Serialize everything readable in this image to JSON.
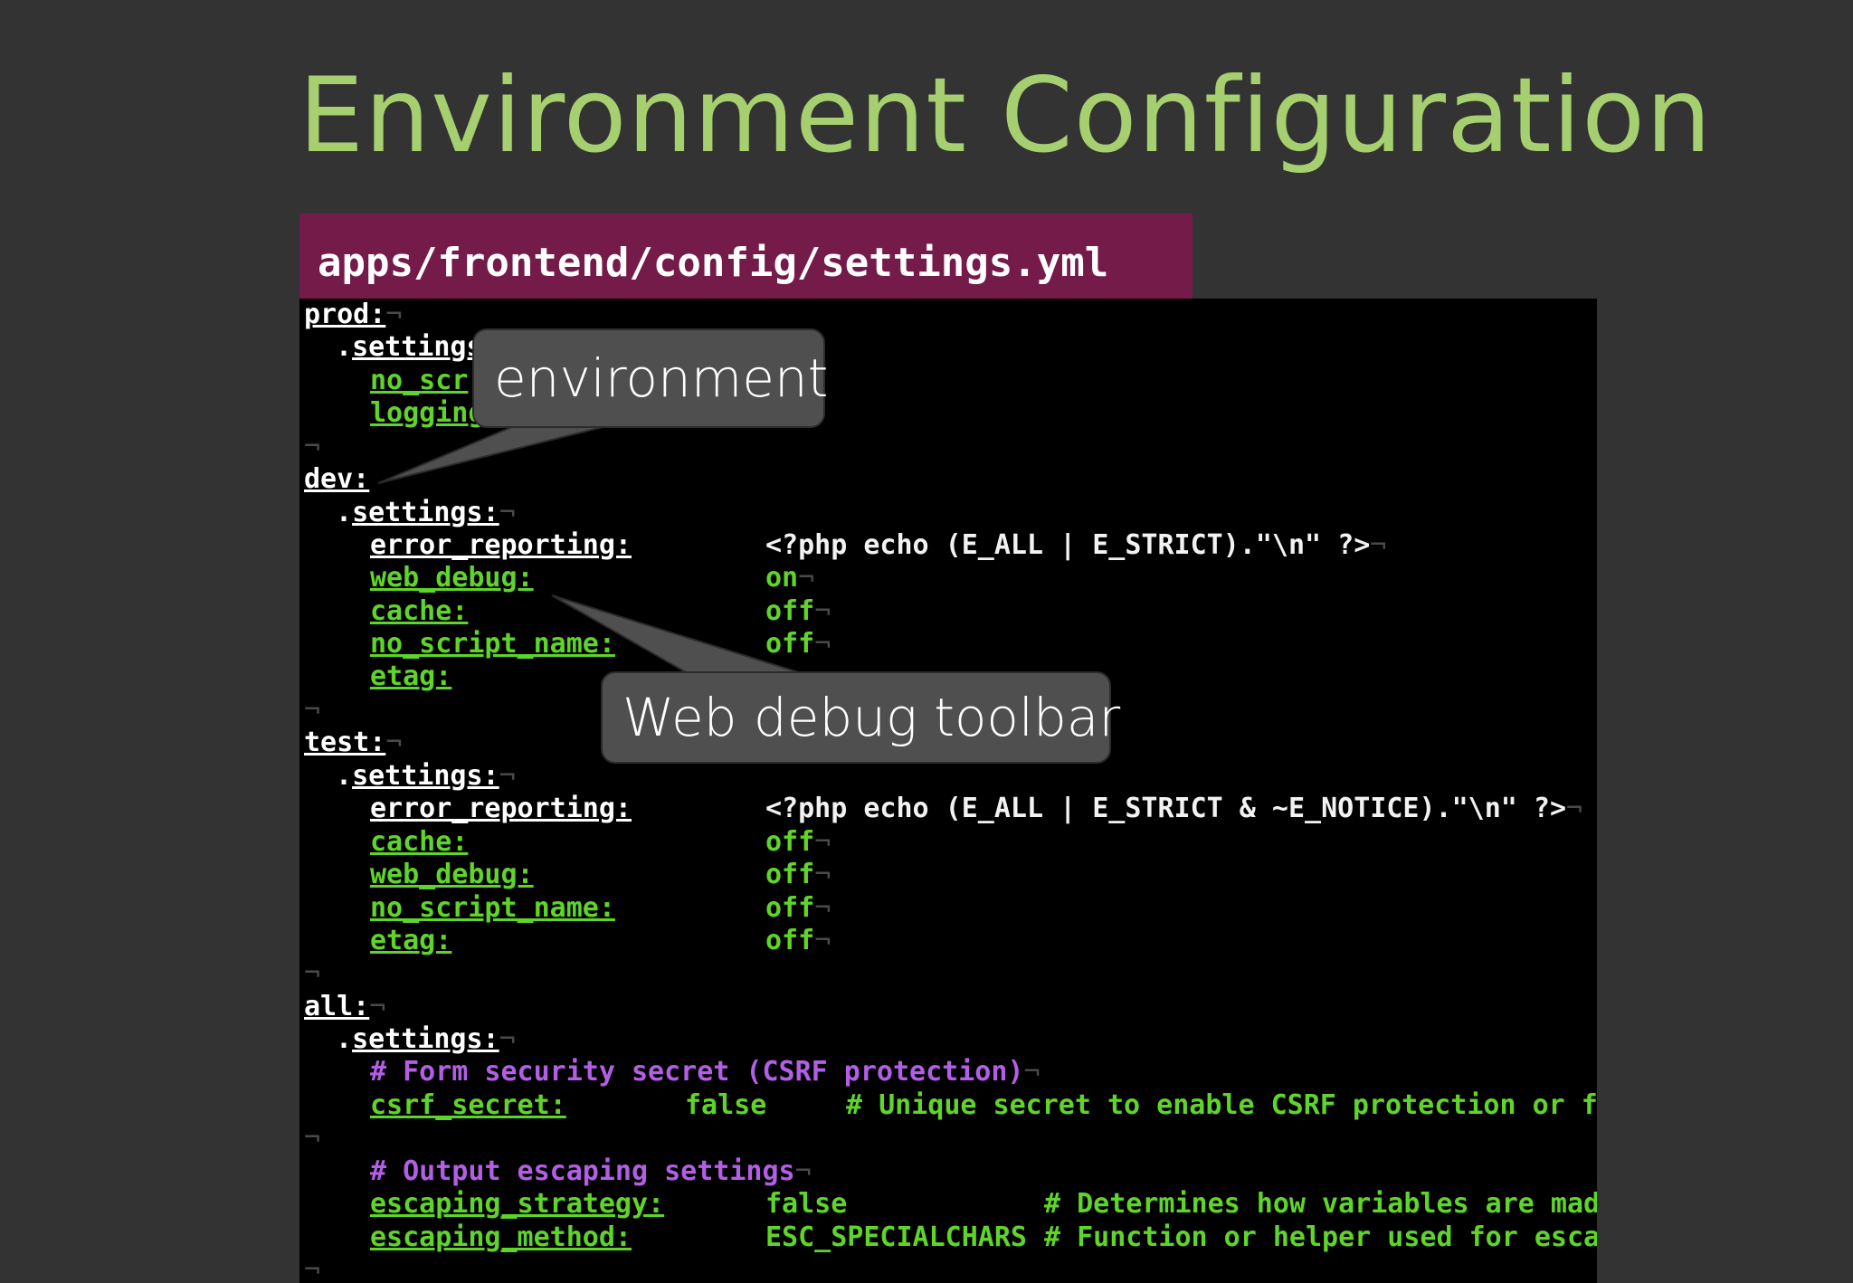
{
  "slide": {
    "title": "Environment Configuration",
    "file_path": "apps/frontend/config/settings.yml"
  },
  "code": {
    "prod_env": "prod:",
    "prod_settings": "settings",
    "prod_row1_key": "no_scr",
    "prod_row2_key": "logging",
    "dev_env": "dev:",
    "dev_settings": "settings:",
    "dev_rows": [
      {
        "key": "error_reporting:",
        "value": "<?php echo (E_ALL | E_STRICT).\"\\n\" ?>"
      },
      {
        "key": "web_debug:",
        "value": "on"
      },
      {
        "key": "cache:",
        "value": "off"
      },
      {
        "key": "no_script_name:",
        "value": "off"
      },
      {
        "key": "etag:",
        "value": ""
      }
    ],
    "test_env": "test:",
    "test_settings": "settings:",
    "test_rows": [
      {
        "key": "error_reporting:",
        "value": "<?php echo (E_ALL | E_STRICT & ~E_NOTICE).\"\\n\" ?>"
      },
      {
        "key": "cache:",
        "value": "off"
      },
      {
        "key": "web_debug:",
        "value": "off"
      },
      {
        "key": "no_script_name:",
        "value": "off"
      },
      {
        "key": "etag:",
        "value": "off"
      }
    ],
    "all_env": "all:",
    "all_settings": "settings:",
    "csrf_comment": "# Form security secret (CSRF protection)",
    "csrf_key": "csrf_secret:",
    "csrf_value": "false",
    "csrf_note": "# Unique secret to enable CSRF protection or f",
    "escaping_comment": "# Output escaping settings",
    "escaping_rows": [
      {
        "key": "escaping_strategy:",
        "value": "false",
        "note": "# Determines how variables are mad"
      },
      {
        "key": "escaping_method:",
        "value": "ESC_SPECIALCHARS",
        "note": "# Function or helper used for esca"
      }
    ]
  },
  "callouts": {
    "environment": "environment",
    "web_debug_toolbar": "Web debug toolbar"
  },
  "colors": {
    "background": "#333333",
    "title": "#a6cf6f",
    "file_tab": "#741b4a",
    "terminal": "#000000",
    "key_green": "#5fd42a",
    "comment_purple": "#b25fe6",
    "callout": "#4f4f4f"
  }
}
